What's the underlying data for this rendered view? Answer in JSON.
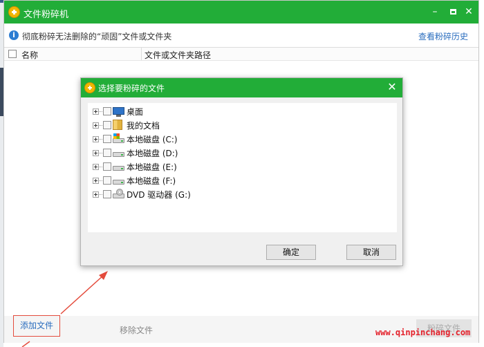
{
  "main_window": {
    "title": "文件粉碎机",
    "controls": {
      "minimize": "–",
      "close": "✕"
    },
    "info_text": "彻底粉碎无法删除的“顽固”文件或文件夹",
    "history_link": "查看粉碎历史",
    "columns": {
      "name": "名称",
      "path": "文件或文件夹路径"
    },
    "footer": {
      "add_label": "添加文件",
      "remove_label": "移除文件",
      "shred_label": "粉碎文件"
    }
  },
  "watermark": "www.qinpinchang.com",
  "dialog": {
    "title": "选择要粉碎的文件",
    "close": "✕",
    "tree": [
      {
        "label": "桌面",
        "icon": "desktop-icon"
      },
      {
        "label": "我的文档",
        "icon": "documents-folder-icon"
      },
      {
        "label": "本地磁盘 (C:)",
        "icon": "system-drive-icon"
      },
      {
        "label": "本地磁盘 (D:)",
        "icon": "drive-icon"
      },
      {
        "label": "本地磁盘 (E:)",
        "icon": "drive-icon"
      },
      {
        "label": "本地磁盘 (F:)",
        "icon": "drive-icon"
      },
      {
        "label": "DVD 驱动器 (G:)",
        "icon": "dvd-drive-icon"
      }
    ],
    "ok_label": "确定",
    "cancel_label": "取消"
  },
  "colors": {
    "titlebar": "#22ad38",
    "link": "#2a6dbe",
    "annotation": "#e44b3c",
    "watermark": "#e4202a"
  }
}
